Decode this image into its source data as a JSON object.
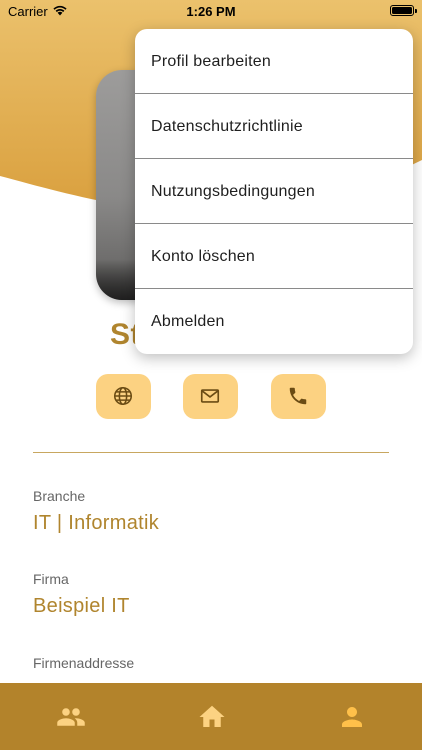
{
  "status_bar": {
    "carrier": "Carrier",
    "time": "1:26 PM"
  },
  "profile": {
    "name_visible": "St",
    "avatar_icon": "profile-photo",
    "contact_buttons": [
      "globe-icon",
      "mail-icon",
      "phone-icon"
    ]
  },
  "fields": [
    {
      "label": "Branche",
      "value": "IT | Informatik"
    },
    {
      "label": "Firma",
      "value": "Beispiel IT"
    },
    {
      "label": "Firmenaddresse",
      "value": ""
    }
  ],
  "menu": {
    "items": [
      {
        "label": "Profil bearbeiten"
      },
      {
        "label": "Datenschutzrichtlinie"
      },
      {
        "label": "Nutzungsbedingungen"
      },
      {
        "label": "Konto löschen"
      },
      {
        "label": "Abmelden"
      }
    ]
  },
  "tab_bar": {
    "tabs": [
      {
        "icon": "people-icon",
        "active": false
      },
      {
        "icon": "home-icon",
        "active": false
      },
      {
        "icon": "person-icon",
        "active": true
      }
    ]
  },
  "colors": {
    "accent": "#b0852e",
    "header_gold": "#e3ad50",
    "button_fill": "#fcd282",
    "tab_bar": "#b3832b",
    "active_tab": "#ffc04a",
    "inactive_tab": "#fcd282"
  }
}
